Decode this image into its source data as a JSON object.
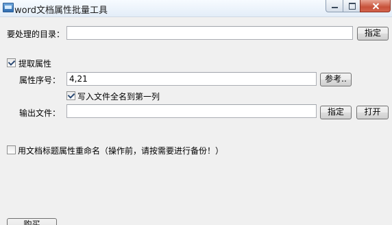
{
  "window": {
    "title": "word文档属性批量工具"
  },
  "directory": {
    "label": "要处理的目录：",
    "value": "",
    "button": "指定"
  },
  "extract": {
    "checkbox_label": "提取属性",
    "checked": true,
    "index_label": "属性序号：",
    "index_value": "4,21",
    "reference_button": "参考..",
    "write_filename_label": "写入文件全名到第一列",
    "write_filename_checked": true,
    "output_label": "输出文件：",
    "output_value": "",
    "output_specify_button": "指定",
    "output_open_button": "打开"
  },
  "rename": {
    "checkbox_label": "用文档标题属性重命名（操作前，请按需要进行备份！）",
    "checked": false
  },
  "footer": {
    "button_partial": "购买"
  }
}
